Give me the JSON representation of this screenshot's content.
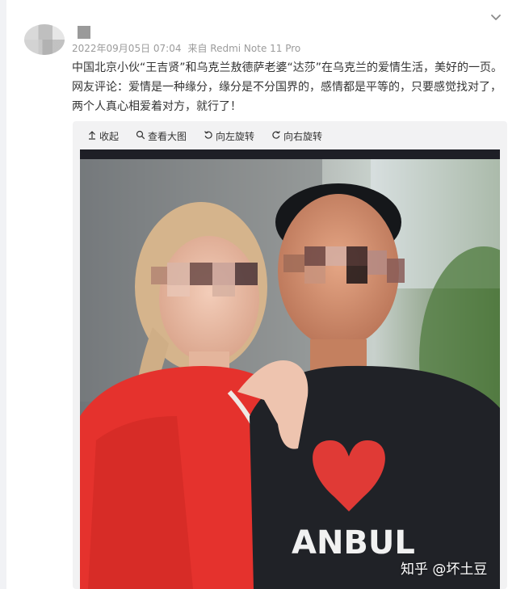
{
  "post": {
    "meta": {
      "timestamp": "2022年09月05日 07:04",
      "source": "来自 Redmi Note 11 Pro"
    },
    "text": {
      "line1": "中国北京小伙“王吉贤”和乌克兰敖德萨老婆“达莎”在乌克兰的爱情生活，美好的一页。",
      "line2": "网友评论：爱情是一种缘分，缘分是不分国界的，感情都是平等的，只要感觉找对了，",
      "line3": "两个人真心相爱着对方，就行了！"
    }
  },
  "toolbar": {
    "collapse_label": "收起",
    "view_large_label": "查看大图",
    "rotate_left_label": "向左旋转",
    "rotate_right_label": "向右旋转"
  },
  "image": {
    "shirt_text": "ANBUL",
    "watermark": "知乎 @坏土豆"
  },
  "icons": {
    "collapse": "arrow-up-icon",
    "view_large": "magnifier-icon",
    "rotate_left": "rotate-left-icon",
    "rotate_right": "rotate-right-icon",
    "dropdown": "chevron-down-icon"
  }
}
